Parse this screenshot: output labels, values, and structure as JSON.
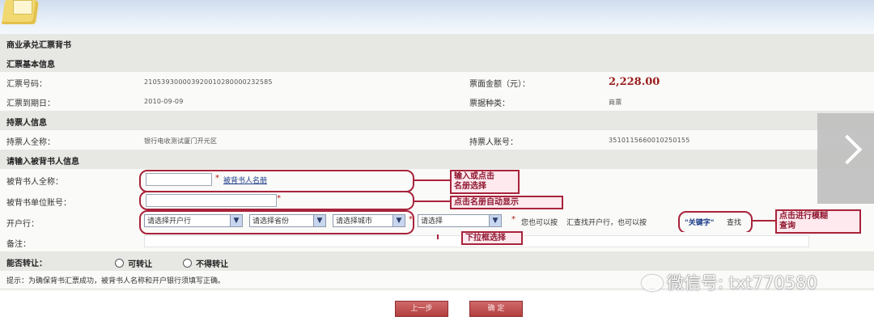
{
  "form": {
    "title": "商业承兑汇票背书",
    "section_bill_info": "汇票基本信息",
    "bill_number_label": "汇票号码：",
    "bill_number_value": "210539300003920010280000232585",
    "amount_label": "票面金额（元）：",
    "amount_value": "2,228.00",
    "due_date_label": "汇票到期日：",
    "due_date_value": "2010-09-09",
    "bill_type_label": "票据种类：",
    "bill_type_value": "商票",
    "section_holder": "持票人信息",
    "holder_name_label": "持票人全称：",
    "holder_name_value": "银行电收测试厦门开元区",
    "holder_account_label": "持票人账号：",
    "holder_account_value": "3510115660010250155",
    "section_endorsee": "请输入被背书人信息",
    "endorsee_name_label": "被背书人全称：",
    "endorsee_name_hint": "被背书人名册",
    "endorsee_account_label": "被背书单位账号：",
    "required_mark": "*",
    "bank_label": "开户行：",
    "bank_select_1": "请选择开户行",
    "bank_select_2": "请选择省份",
    "bank_select_3": "请选择城市",
    "bank_select_4": "请选择",
    "bank_hint_1": "您也可以按",
    "bank_hint_2": "汇查找开户行，也可以按",
    "keyword": "\"关键字\"",
    "search_text": "查找",
    "remark_label": "备注：",
    "transfer_label": "能否转让：",
    "transfer_option_1": "可转让",
    "transfer_option_2": "不得转让",
    "tip": "提示：为确保背书汇票成功，被背书人名称和开户银行须填写正确。",
    "prev_button": "上一步",
    "confirm_button": "确 定"
  },
  "annotations": {
    "name_callout": "输入或点击\n名册选择",
    "account_callout": "点击名册自动显示",
    "dropdown_callout": "下拉框选择",
    "search_callout": "点击进行模糊\n查询"
  },
  "watermark": "微信号: txt770580"
}
